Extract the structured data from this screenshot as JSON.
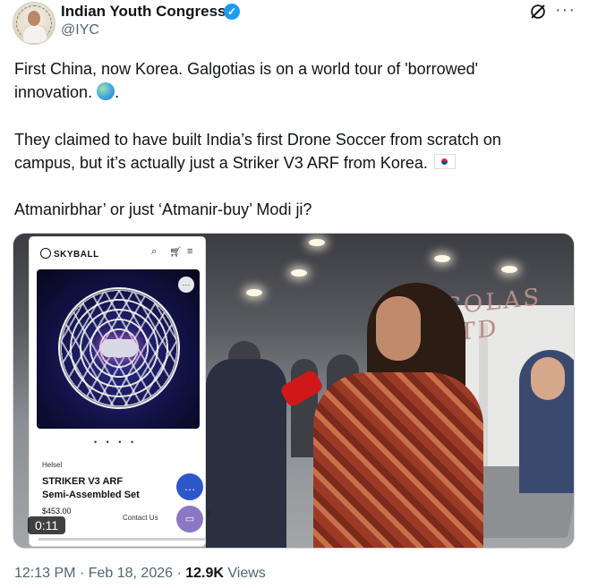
{
  "tweet": {
    "author": {
      "name": "Indian Youth Congress",
      "handle": "@IYC",
      "verified": true,
      "avatar_icon": "profile-avatar"
    },
    "text_lines": {
      "line1": "First China, now Korea. Galgotias is on a world tour of 'borrowed'",
      "line2": "innovation.",
      "line2_suffix": ".",
      "line3": "They claimed to have built India’s first Drone Soccer from scratch on",
      "line4": "campus, but it’s actually just a Striker V3 ARF from Korea.",
      "line5": "Atmanirbhar’ or just ‘Atmanir-buy’ Modi ji?"
    },
    "emojis": {
      "globe": "globe-emoji",
      "flag": "south-korea-flag-emoji"
    },
    "media": {
      "phone_overlay": {
        "brand": "SKYBALL",
        "seller": "Helsel",
        "product_name_line1": "STRIKER V3 ARF",
        "product_name_line2": "Semi-Assembled Set",
        "price": "$453.00",
        "contact_label": "Contact Us",
        "carousel_dots": "• • • •",
        "header_icons": [
          "search-icon",
          "cart-icon",
          "menu-icon"
        ]
      },
      "background_sign": "COLAS LTD",
      "edge_char": "0",
      "video_duration": "0:11",
      "video_progress": 0.05
    },
    "meta": {
      "time": "12:13 PM",
      "separator": "·",
      "date": "Feb 18, 2026",
      "views_count": "12.9K",
      "views_label": "Views"
    },
    "colors": {
      "accent": "#1d9bf0",
      "text": "#0f1419",
      "muted": "#536471"
    }
  }
}
